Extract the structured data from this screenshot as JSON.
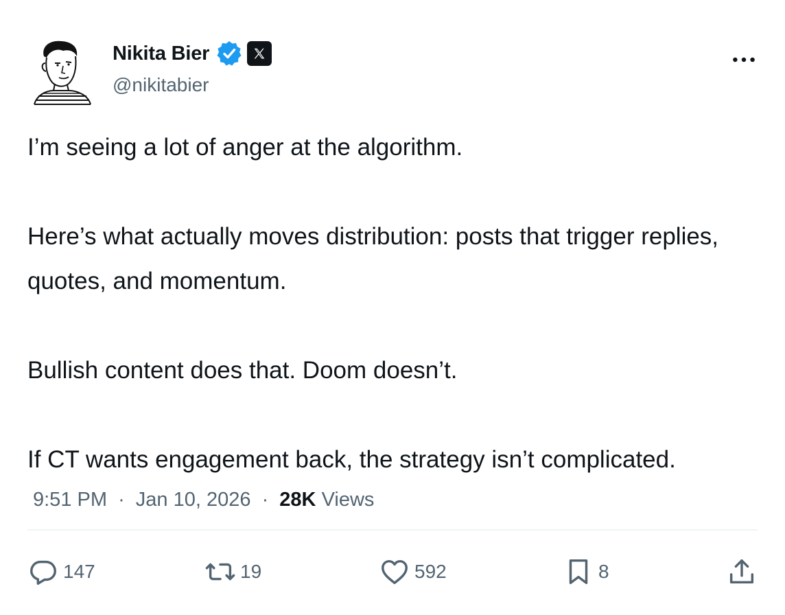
{
  "author": {
    "name": "Nikita Bier",
    "handle": "@nikitabier",
    "avatar_icon": "sketch-portrait-avatar",
    "verified_icon": "verified-badge-icon",
    "affiliation_icon": "x-logo-icon",
    "verified_color": "#1d9bf0"
  },
  "more_icon": "more-options-icon",
  "tweet": {
    "paragraphs": [
      "I’m seeing a lot of anger at the algorithm.",
      "Here’s what actually moves distribution: posts that trigger replies, quotes, and momentum.",
      "Bullish content does that. Doom doesn’t.",
      "If CT wants engagement back, the strategy isn’t complicated."
    ]
  },
  "meta": {
    "time": "9:51 PM",
    "separator": "·",
    "date": "Jan 10, 2026",
    "views_count": "28K",
    "views_label": "Views"
  },
  "actions": {
    "replies": {
      "icon": "reply-icon",
      "count": "147"
    },
    "reposts": {
      "icon": "repost-icon",
      "count": "19"
    },
    "likes": {
      "icon": "heart-icon",
      "count": "592"
    },
    "bookmarks": {
      "icon": "bookmark-icon",
      "count": "8"
    },
    "share": {
      "icon": "share-icon"
    }
  },
  "colors": {
    "text_primary": "#0f1419",
    "text_secondary": "#536471",
    "divider": "#eff3f4"
  }
}
